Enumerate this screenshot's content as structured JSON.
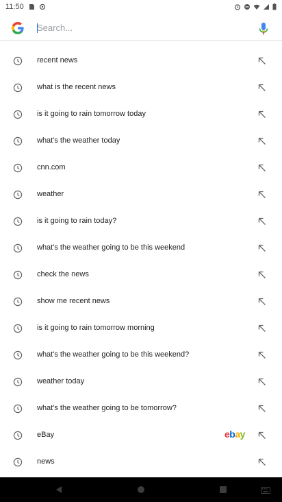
{
  "status": {
    "time": "11:50"
  },
  "search": {
    "placeholder": "Search..."
  },
  "suggestions": [
    {
      "label": "recent news"
    },
    {
      "label": "what is the recent news"
    },
    {
      "label": "is it going to rain tomorrow today"
    },
    {
      "label": "what's the weather today"
    },
    {
      "label": "cnn.com"
    },
    {
      "label": "weather"
    },
    {
      "label": "is it going to rain today?"
    },
    {
      "label": "what's the weather going to be this weekend"
    },
    {
      "label": "check the news"
    },
    {
      "label": "show me recent news"
    },
    {
      "label": "is it going to rain tomorrow morning"
    },
    {
      "label": "what's the weather going to be this weekend?"
    },
    {
      "label": "weather today"
    },
    {
      "label": "what's the weather going to be tomorrow?"
    },
    {
      "label": "eBay",
      "brand_logo": "ebay"
    },
    {
      "label": "news"
    }
  ],
  "ebay_logo": {
    "e": "e",
    "b": "b",
    "a": "a",
    "y": "y"
  }
}
